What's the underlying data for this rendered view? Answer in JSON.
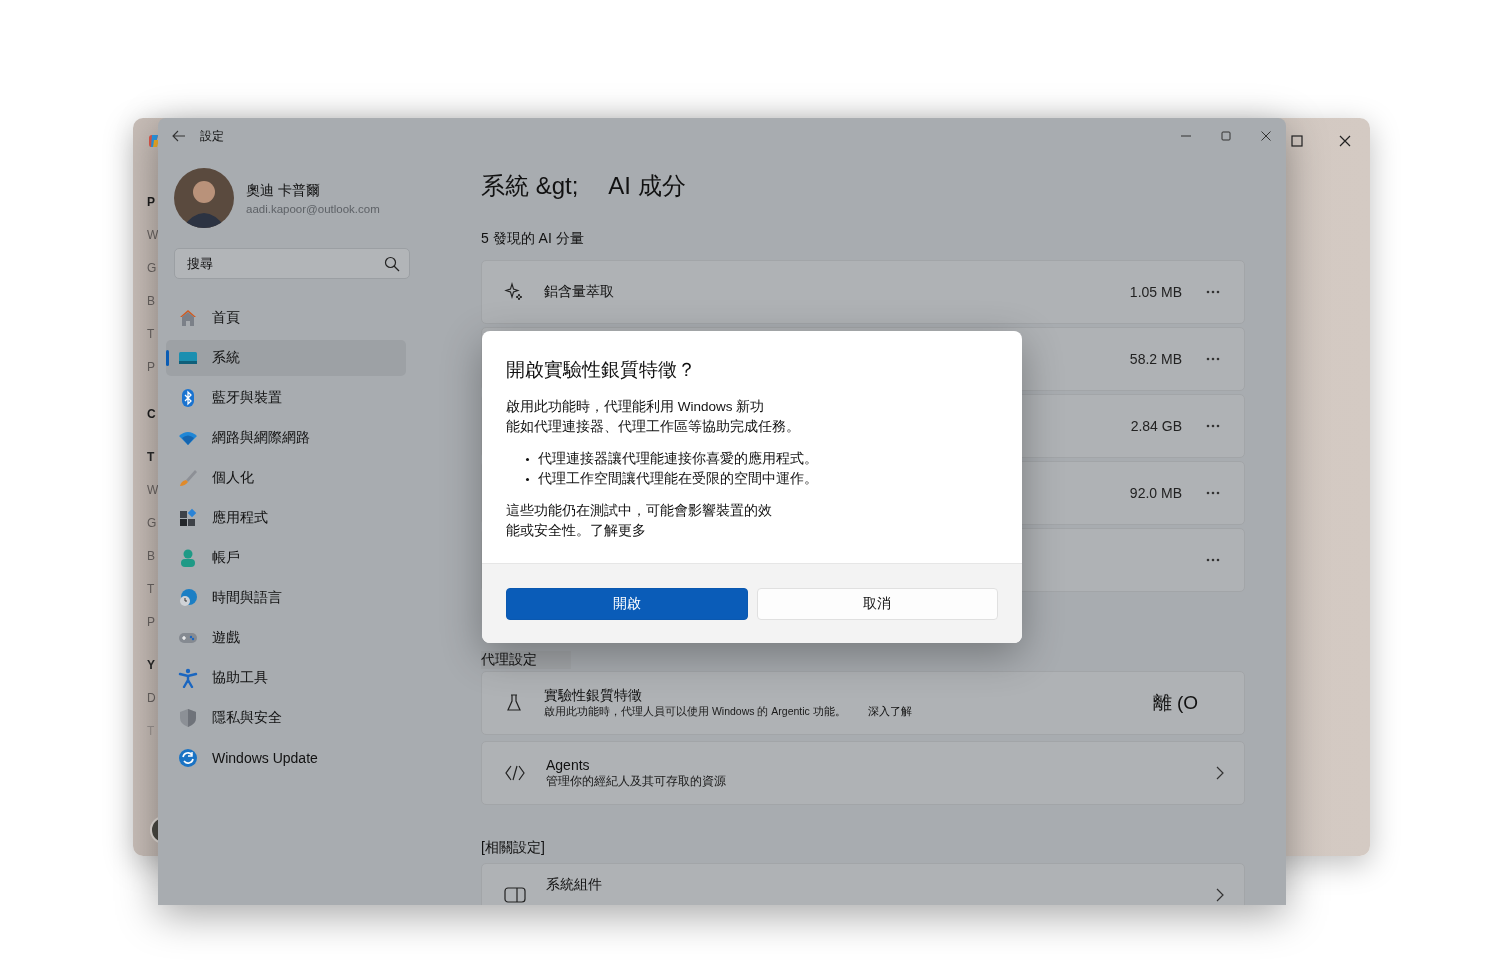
{
  "back_window": {
    "fragments": [
      {
        "label": "P",
        "kind": "heading"
      },
      {
        "label": "W",
        "kind": "item"
      },
      {
        "label": "G",
        "kind": "item"
      },
      {
        "label": "B",
        "kind": "item"
      },
      {
        "label": "T",
        "kind": "item"
      },
      {
        "label": "P",
        "kind": "item"
      },
      {
        "label": "C",
        "kind": "heading"
      },
      {
        "label": "T",
        "kind": "subheading"
      },
      {
        "label": "W",
        "kind": "item"
      },
      {
        "label": "G",
        "kind": "item"
      },
      {
        "label": "B",
        "kind": "item"
      },
      {
        "label": "T",
        "kind": "item"
      },
      {
        "label": "P",
        "kind": "item"
      },
      {
        "label": "Y",
        "kind": "subheading"
      },
      {
        "label": "D",
        "kind": "item"
      },
      {
        "label": "T",
        "kind": "faint"
      }
    ]
  },
  "window": {
    "title": "設定"
  },
  "profile": {
    "name": "奧迪 卡普爾",
    "email": "aadi.kapoor@outlook.com"
  },
  "search": {
    "placeholder": "搜尋"
  },
  "sidebar": {
    "items": [
      {
        "label": "首頁",
        "selected": false
      },
      {
        "label": "系統",
        "selected": true
      },
      {
        "label": "藍牙與裝置",
        "selected": false
      },
      {
        "label": "網路與網際網路",
        "selected": false
      },
      {
        "label": "個人化",
        "selected": false
      },
      {
        "label": "應用程式",
        "selected": false
      },
      {
        "label": "帳戶",
        "selected": false
      },
      {
        "label": "時間與語言",
        "selected": false
      },
      {
        "label": "遊戲",
        "selected": false
      },
      {
        "label": "協助工具",
        "selected": false
      },
      {
        "label": "隱私與安全",
        "selected": false
      },
      {
        "label": "Windows Update",
        "selected": false
      }
    ]
  },
  "breadcrumb": [
    "系統 &gt;",
    "AI 成分"
  ],
  "components": {
    "heading": "5 發現的 AI 分量",
    "rows": [
      {
        "name": "鋁含量萃取",
        "size": "1.05 MB"
      },
      {
        "size": "58.2 MB"
      },
      {
        "size": "2.84 GB"
      },
      {
        "size": "92.0 MB"
      },
      {}
    ]
  },
  "agent_settings": {
    "heading": "代理設定",
    "cards": [
      {
        "kind": "toggle",
        "title": "實驗性銀質特徵",
        "description": "啟用此功能時，代理人員可以使用 Windows 的 Argentic 功能。",
        "link": "深入了解",
        "toggle_label": "離 (O"
      },
      {
        "kind": "link",
        "title": "Agents",
        "description": "管理你的經紀人及其可存取的資源"
      }
    ]
  },
  "related": {
    "heading": "[相關設定]",
    "cards": [
      {
        "kind": "link",
        "title": "系統組件"
      }
    ]
  },
  "dialog": {
    "title": "開啟實驗性銀質特徵？",
    "intro": [
      "啟用此功能時，代理能利用 Windows 新功",
      "能如代理連接器、代理工作區等協助完成任務。"
    ],
    "bullets": [
      "代理連接器讓代理能連接你喜愛的應用程式。",
      "代理工作空間讓代理能在受限的空間中運作。"
    ],
    "note": [
      "這些功能仍在測試中，可能會影響裝置的效",
      "能或安全性。了解更多"
    ],
    "buttons": [
      {
        "label": "開啟",
        "kind": "primary"
      },
      {
        "label": "取消",
        "kind": "secondary"
      }
    ]
  }
}
